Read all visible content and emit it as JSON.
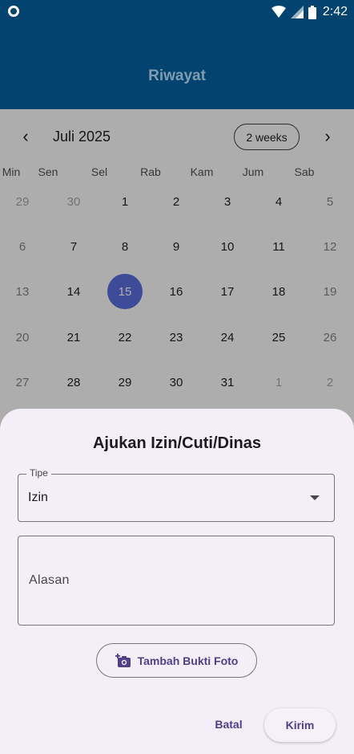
{
  "status_bar": {
    "time": "2:42",
    "icons": [
      "notification-circle-icon",
      "wifi-icon",
      "signal-icon",
      "battery-icon"
    ]
  },
  "app_bar": {
    "title": "Riwayat"
  },
  "calendar": {
    "month": "Juli 2025",
    "format_button": "2 weeks",
    "prev_icon": "‹",
    "next_icon": "›",
    "weekdays": [
      "Min",
      "Sen",
      "Sel",
      "Rab",
      "Kam",
      "Jum",
      "Sab"
    ],
    "weeks": [
      [
        "29",
        "30",
        "1",
        "2",
        "3",
        "4",
        "5"
      ],
      [
        "6",
        "7",
        "8",
        "9",
        "10",
        "11",
        "12"
      ],
      [
        "13",
        "14",
        "15",
        "16",
        "17",
        "18",
        "19"
      ],
      [
        "20",
        "21",
        "22",
        "23",
        "24",
        "25",
        "26"
      ],
      [
        "27",
        "28",
        "29",
        "30",
        "31",
        "1",
        "2"
      ]
    ],
    "selected_day": "15",
    "selected_color": "#5b6fe0"
  },
  "sheet": {
    "title": "Ajukan Izin/Cuti/Dinas",
    "type_field": {
      "label": "Tipe",
      "value": "Izin"
    },
    "reason_field": {
      "placeholder": "Alasan"
    },
    "photo_button": {
      "label": "Tambah Bukti Foto",
      "icon": "add-photo-icon"
    },
    "cancel_label": "Batal",
    "submit_label": "Kirim",
    "accent_color": "#4f3f8c"
  }
}
